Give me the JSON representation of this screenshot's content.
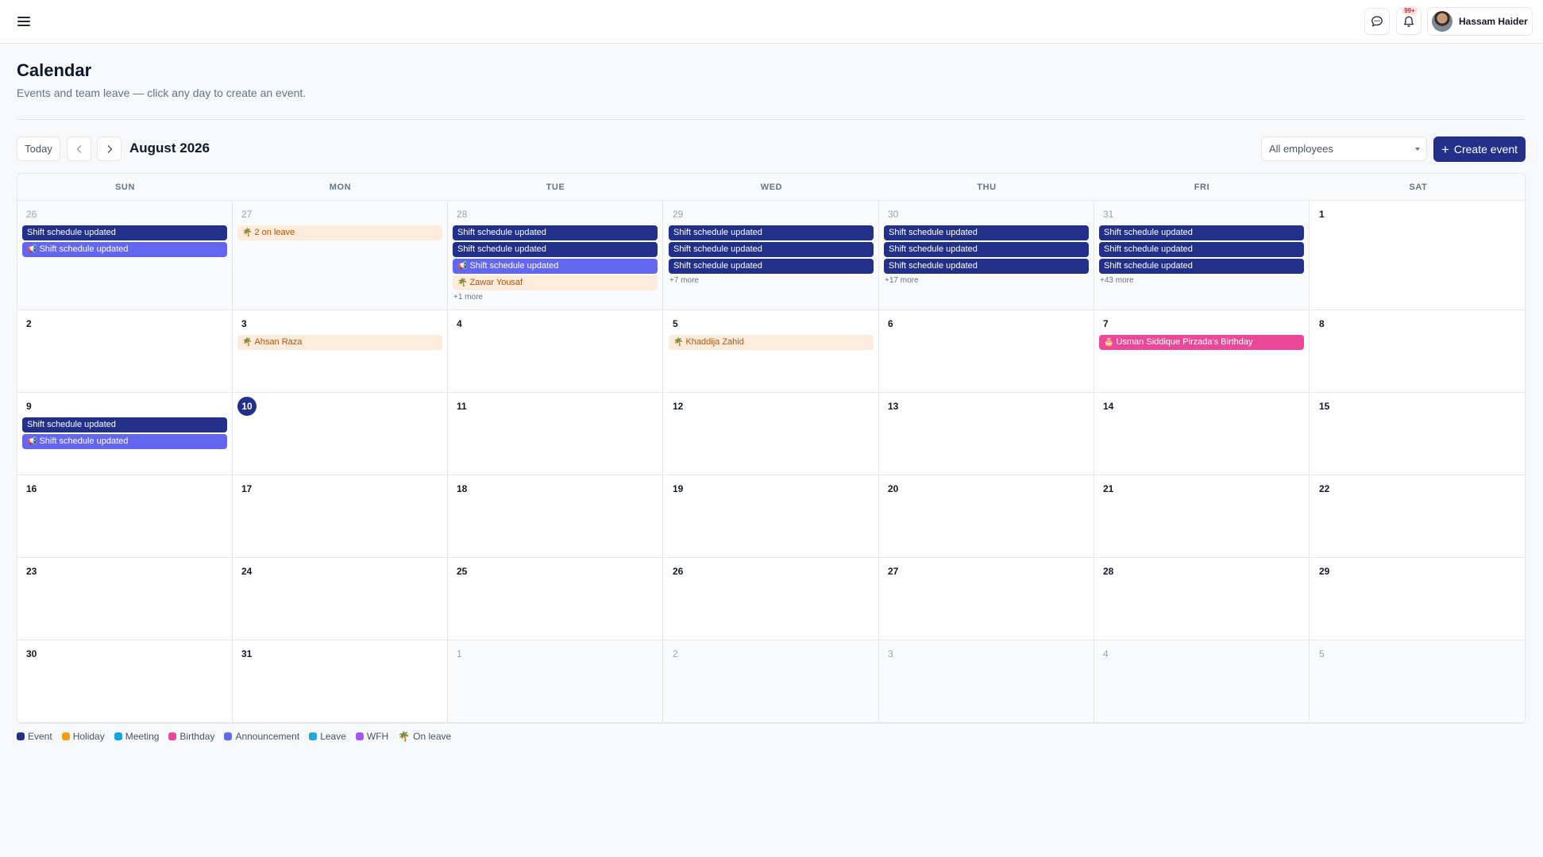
{
  "topbar": {
    "user_name": "Hassam Haider",
    "notifications_badge": "99+",
    "icons": [
      "menu-icon",
      "chat-icon",
      "bell-icon"
    ]
  },
  "header": {
    "title": "Calendar",
    "subtitle": "Events and team leave — click any day to create an event."
  },
  "toolbar": {
    "today_label": "Today",
    "month_label": "August 2026",
    "employee_filter": "All employees",
    "create_label": "Create event"
  },
  "calendar": {
    "weekdays": [
      "SUN",
      "MON",
      "TUE",
      "WED",
      "THU",
      "FRI",
      "SAT"
    ],
    "weeks": [
      [
        {
          "day": "26",
          "outside": true,
          "events": [
            {
              "type": "event",
              "label": "Shift schedule updated"
            },
            {
              "type": "announcement",
              "icon": "📢",
              "label": "Shift schedule updated"
            }
          ]
        },
        {
          "day": "27",
          "outside": true,
          "events": [
            {
              "type": "leave",
              "icon": "🌴",
              "label": "2 on leave"
            }
          ]
        },
        {
          "day": "28",
          "outside": true,
          "events": [
            {
              "type": "event",
              "label": "Shift schedule updated"
            },
            {
              "type": "event",
              "label": "Shift schedule updated"
            },
            {
              "type": "announcement",
              "icon": "📢",
              "label": "Shift schedule updated"
            },
            {
              "type": "leave",
              "icon": "🌴",
              "label": "Zawar Yousaf"
            }
          ],
          "more": "+1 more"
        },
        {
          "day": "29",
          "outside": true,
          "events": [
            {
              "type": "event",
              "label": "Shift schedule updated"
            },
            {
              "type": "event",
              "label": "Shift schedule updated"
            },
            {
              "type": "event",
              "label": "Shift schedule updated"
            }
          ],
          "more": "+7 more"
        },
        {
          "day": "30",
          "outside": true,
          "events": [
            {
              "type": "event",
              "label": "Shift schedule updated"
            },
            {
              "type": "event",
              "label": "Shift schedule updated"
            },
            {
              "type": "event",
              "label": "Shift schedule updated"
            }
          ],
          "more": "+17 more"
        },
        {
          "day": "31",
          "outside": true,
          "events": [
            {
              "type": "event",
              "label": "Shift schedule updated"
            },
            {
              "type": "event",
              "label": "Shift schedule updated"
            },
            {
              "type": "event",
              "label": "Shift schedule updated"
            }
          ],
          "more": "+43 more"
        },
        {
          "day": "1",
          "outside": false,
          "events": []
        }
      ],
      [
        {
          "day": "2",
          "outside": false,
          "events": []
        },
        {
          "day": "3",
          "outside": false,
          "events": [
            {
              "type": "leave",
              "icon": "🌴",
              "label": "Ahsan Raza"
            }
          ]
        },
        {
          "day": "4",
          "outside": false,
          "events": []
        },
        {
          "day": "5",
          "outside": false,
          "events": [
            {
              "type": "leave",
              "icon": "🌴",
              "label": "Khaddija Zahid"
            }
          ]
        },
        {
          "day": "6",
          "outside": false,
          "events": []
        },
        {
          "day": "7",
          "outside": false,
          "events": [
            {
              "type": "birthday",
              "icon": "🎂",
              "label": "Usman Siddique Pirzada's Birthday"
            }
          ]
        },
        {
          "day": "8",
          "outside": false,
          "events": []
        }
      ],
      [
        {
          "day": "9",
          "outside": false,
          "events": [
            {
              "type": "event",
              "label": "Shift schedule updated"
            },
            {
              "type": "announcement",
              "icon": "📢",
              "label": "Shift schedule updated"
            }
          ]
        },
        {
          "day": "10",
          "outside": false,
          "today": true,
          "events": []
        },
        {
          "day": "11",
          "outside": false,
          "events": []
        },
        {
          "day": "12",
          "outside": false,
          "events": []
        },
        {
          "day": "13",
          "outside": false,
          "events": []
        },
        {
          "day": "14",
          "outside": false,
          "events": []
        },
        {
          "day": "15",
          "outside": false,
          "events": []
        }
      ],
      [
        {
          "day": "16",
          "outside": false,
          "events": []
        },
        {
          "day": "17",
          "outside": false,
          "events": []
        },
        {
          "day": "18",
          "outside": false,
          "events": []
        },
        {
          "day": "19",
          "outside": false,
          "events": []
        },
        {
          "day": "20",
          "outside": false,
          "events": []
        },
        {
          "day": "21",
          "outside": false,
          "events": []
        },
        {
          "day": "22",
          "outside": false,
          "events": []
        }
      ],
      [
        {
          "day": "23",
          "outside": false,
          "events": []
        },
        {
          "day": "24",
          "outside": false,
          "events": []
        },
        {
          "day": "25",
          "outside": false,
          "events": []
        },
        {
          "day": "26",
          "outside": false,
          "events": []
        },
        {
          "day": "27",
          "outside": false,
          "events": []
        },
        {
          "day": "28",
          "outside": false,
          "events": []
        },
        {
          "day": "29",
          "outside": false,
          "events": []
        }
      ],
      [
        {
          "day": "30",
          "outside": false,
          "events": []
        },
        {
          "day": "31",
          "outside": false,
          "events": []
        },
        {
          "day": "1",
          "outside": true,
          "events": []
        },
        {
          "day": "2",
          "outside": true,
          "events": []
        },
        {
          "day": "3",
          "outside": true,
          "events": []
        },
        {
          "day": "4",
          "outside": true,
          "events": []
        },
        {
          "day": "5",
          "outside": true,
          "events": []
        }
      ]
    ]
  },
  "legend": [
    {
      "label": "Event",
      "color": "#22308a"
    },
    {
      "label": "Holiday",
      "color": "#f59e0b"
    },
    {
      "label": "Meeting",
      "color": "#0ea5e9"
    },
    {
      "label": "Birthday",
      "color": "#ec4899"
    },
    {
      "label": "Announcement",
      "color": "#6366f1"
    },
    {
      "label": "Leave",
      "color": "#22a6d8"
    },
    {
      "label": "WFH",
      "color": "#a855f7"
    },
    {
      "label": "On leave",
      "icon": "🌴"
    }
  ]
}
